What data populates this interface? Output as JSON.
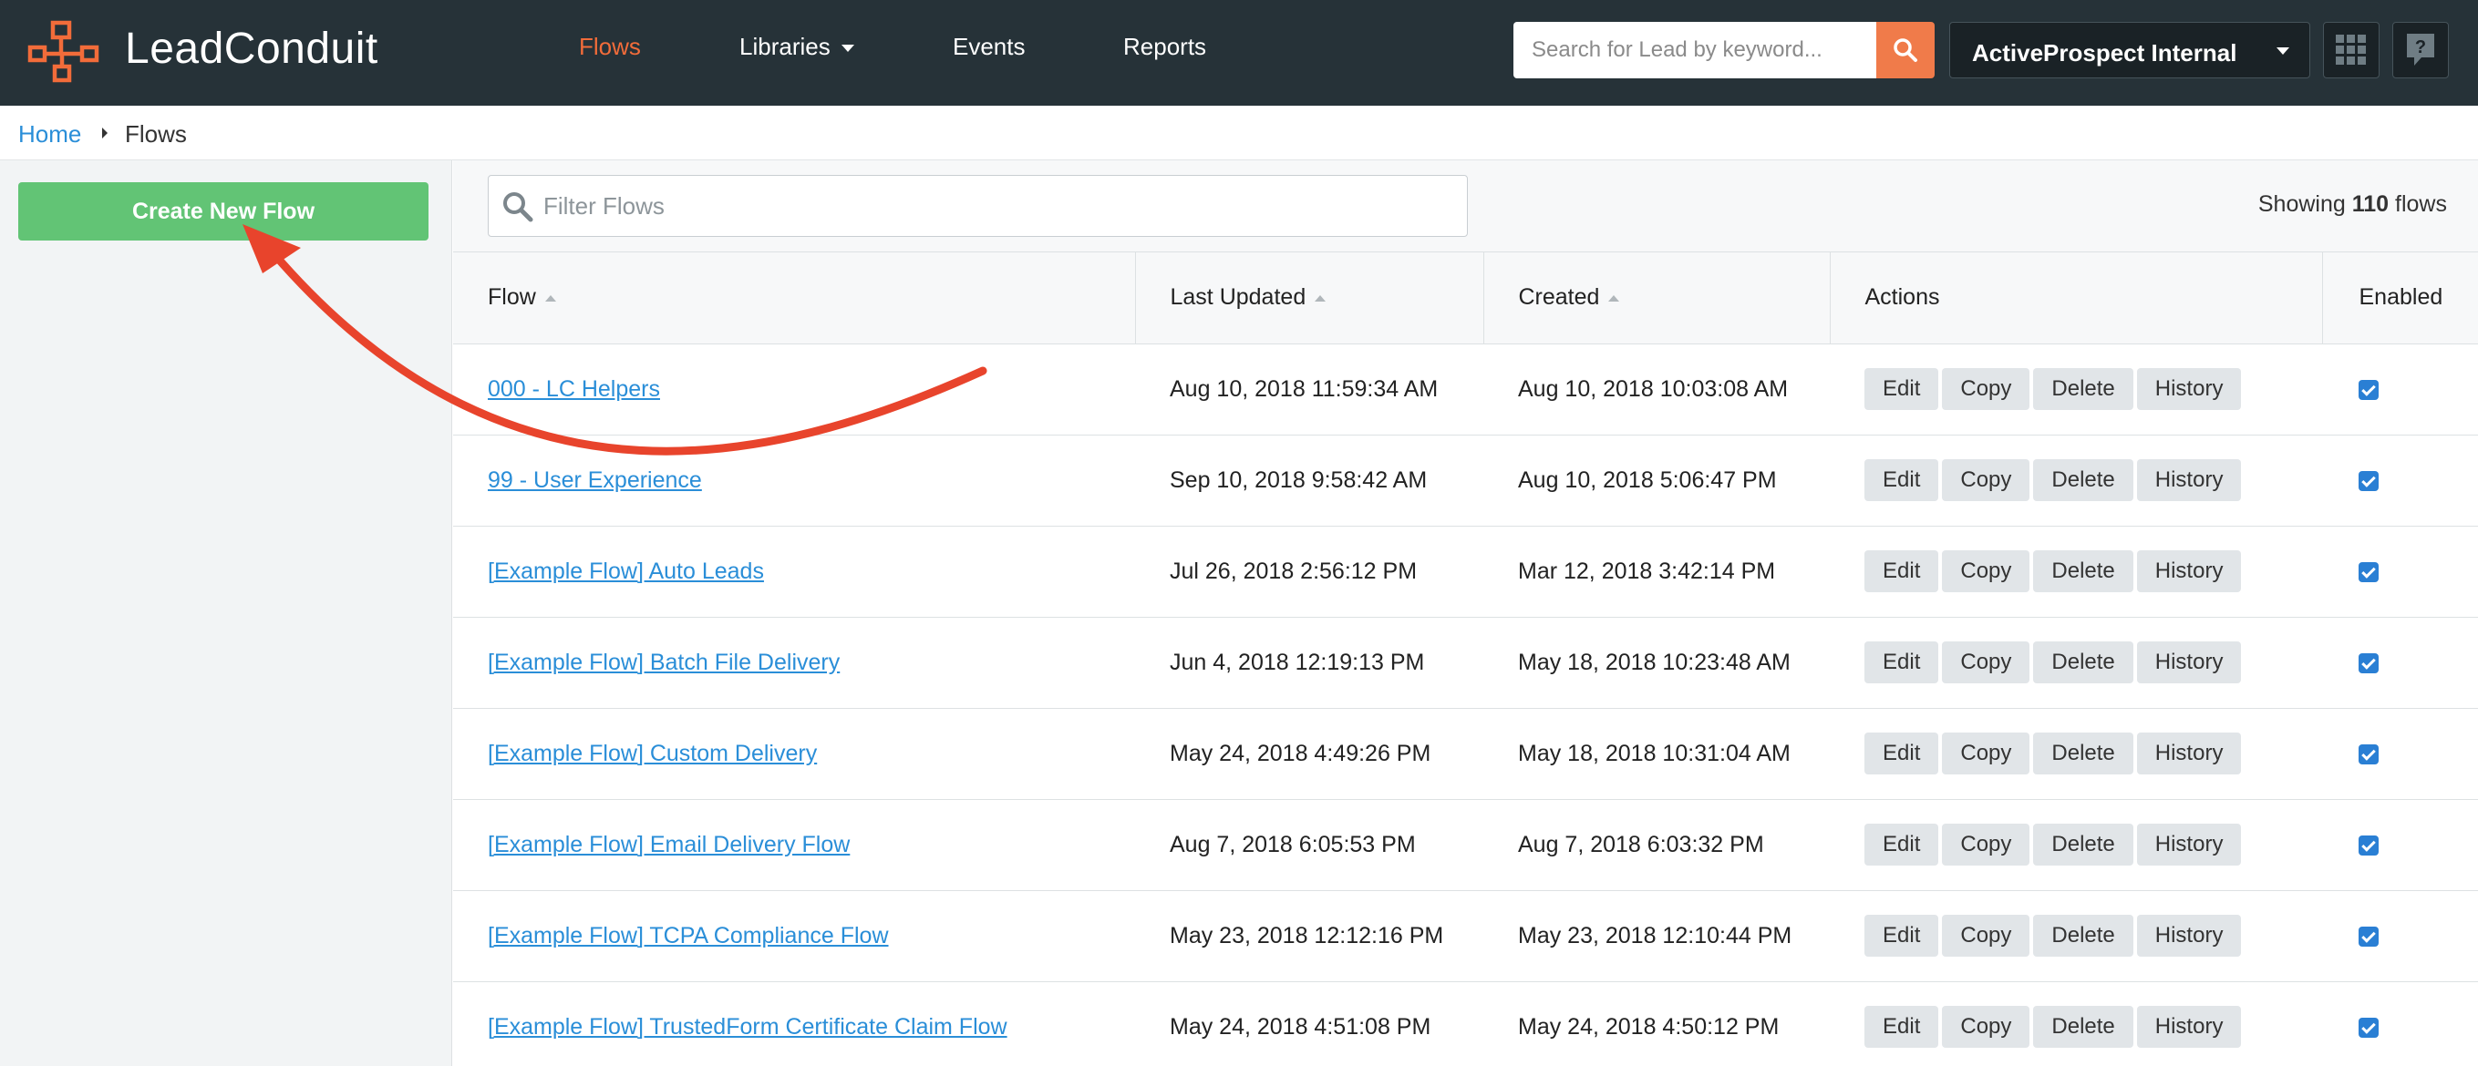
{
  "app": {
    "brand": "LeadConduit"
  },
  "nav": {
    "items": [
      {
        "label": "Flows",
        "active": true
      },
      {
        "label": "Libraries",
        "dropdown": true
      },
      {
        "label": "Events"
      },
      {
        "label": "Reports"
      }
    ]
  },
  "search": {
    "placeholder": "Search for Lead by keyword..."
  },
  "account": {
    "label": "ActiveProspect Internal"
  },
  "breadcrumb": {
    "home": "Home",
    "current": "Flows"
  },
  "sidebar": {
    "create_label": "Create New Flow"
  },
  "filter": {
    "placeholder": "Filter Flows"
  },
  "showing": {
    "prefix": "Showing",
    "count": "110",
    "suffix": "flows"
  },
  "table": {
    "headers": {
      "flow": "Flow",
      "last_updated": "Last Updated",
      "created": "Created",
      "actions": "Actions",
      "enabled": "Enabled"
    },
    "action_labels": {
      "edit": "Edit",
      "copy": "Copy",
      "delete": "Delete",
      "history": "History"
    },
    "rows": [
      {
        "name": "000 - LC Helpers",
        "updated": "Aug 10, 2018 11:59:34 AM",
        "created": "Aug 10, 2018 10:03:08 AM",
        "enabled": true
      },
      {
        "name": "99 - User Experience",
        "updated": "Sep 10, 2018 9:58:42 AM",
        "created": "Aug 10, 2018 5:06:47 PM",
        "enabled": true
      },
      {
        "name": "[Example Flow] Auto Leads",
        "updated": "Jul 26, 2018 2:56:12 PM",
        "created": "Mar 12, 2018 3:42:14 PM",
        "enabled": true
      },
      {
        "name": "[Example Flow] Batch File Delivery",
        "updated": "Jun 4, 2018 12:19:13 PM",
        "created": "May 18, 2018 10:23:48 AM",
        "enabled": true
      },
      {
        "name": "[Example Flow] Custom Delivery",
        "updated": "May 24, 2018 4:49:26 PM",
        "created": "May 18, 2018 10:31:04 AM",
        "enabled": true
      },
      {
        "name": "[Example Flow] Email Delivery Flow",
        "updated": "Aug 7, 2018 6:05:53 PM",
        "created": "Aug 7, 2018 6:03:32 PM",
        "enabled": true
      },
      {
        "name": "[Example Flow] TCPA Compliance Flow",
        "updated": "May 23, 2018 12:12:16 PM",
        "created": "May 23, 2018 12:10:44 PM",
        "enabled": true
      },
      {
        "name": "[Example Flow] TrustedForm Certificate Claim Flow",
        "updated": "May 24, 2018 4:51:08 PM",
        "created": "May 24, 2018 4:50:12 PM",
        "enabled": true
      }
    ]
  },
  "colors": {
    "navbar": "#263238",
    "accent": "#f26c3a",
    "create_button": "#62c475",
    "link": "#2a8ed8",
    "annotation_arrow": "#e8442c"
  },
  "icons": [
    "network-logo-icon",
    "search-icon",
    "grid-icon",
    "help-icon",
    "chevron-down-icon",
    "filter-search-icon",
    "checkbox-icon",
    "annotation-arrow"
  ]
}
